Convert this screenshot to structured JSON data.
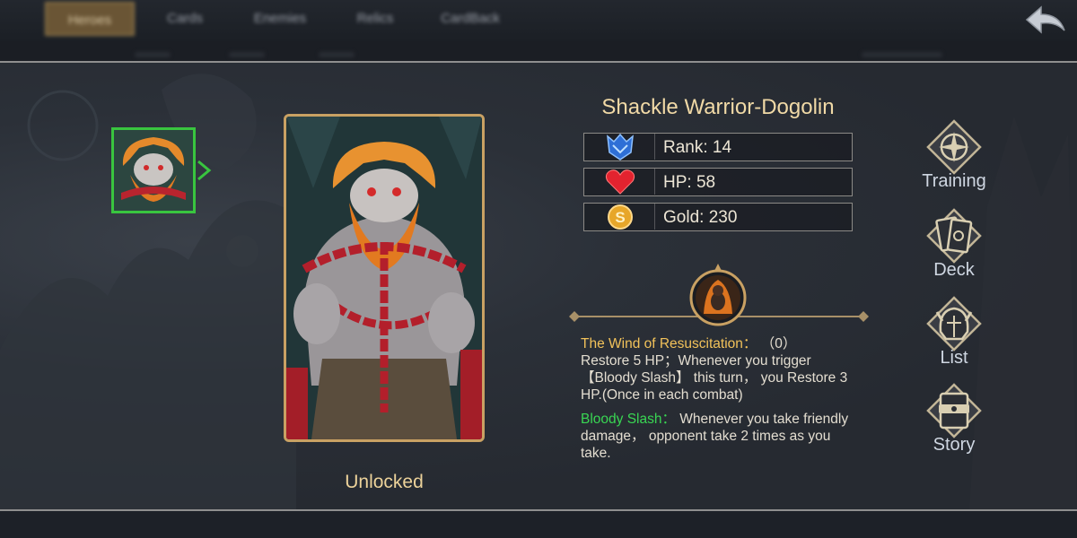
{
  "tabs": [
    {
      "label": "Heroes",
      "active": true
    },
    {
      "label": "Cards",
      "active": false
    },
    {
      "label": "Enemies",
      "active": false
    },
    {
      "label": "Relics",
      "active": false
    },
    {
      "label": "CardBack",
      "active": false
    }
  ],
  "hero": {
    "name": "Shackle Warrior-Dogolin",
    "status": "Unlocked"
  },
  "stats": [
    {
      "icon": "rank-icon",
      "label": "Rank: 14"
    },
    {
      "icon": "heart-icon",
      "label": "HP: 58"
    },
    {
      "icon": "gold-coin-icon",
      "label": "Gold: 230"
    }
  ],
  "skills": [
    {
      "title": "The Wind of Resuscitation：",
      "count": " （0）",
      "text": "Restore 5 HP；Whenever you trigger【Bloody Slash】 this turn， you Restore 3 HP.(Once in each combat)"
    },
    {
      "title": "Bloody Slash：",
      "text": " Whenever you take friendly damage， opponent take 2 times as you take."
    }
  ],
  "menu": [
    {
      "icon": "compass-icon",
      "label": "Training"
    },
    {
      "icon": "cards-icon",
      "label": "Deck"
    },
    {
      "icon": "helmet-icon",
      "label": "List"
    },
    {
      "icon": "book-icon",
      "label": "Story"
    }
  ],
  "colors": {
    "accent_gold": "#c9a163",
    "selected_green": "#39c53f",
    "skill_title": "#f2c25a",
    "skill_title_alt": "#39d653"
  }
}
